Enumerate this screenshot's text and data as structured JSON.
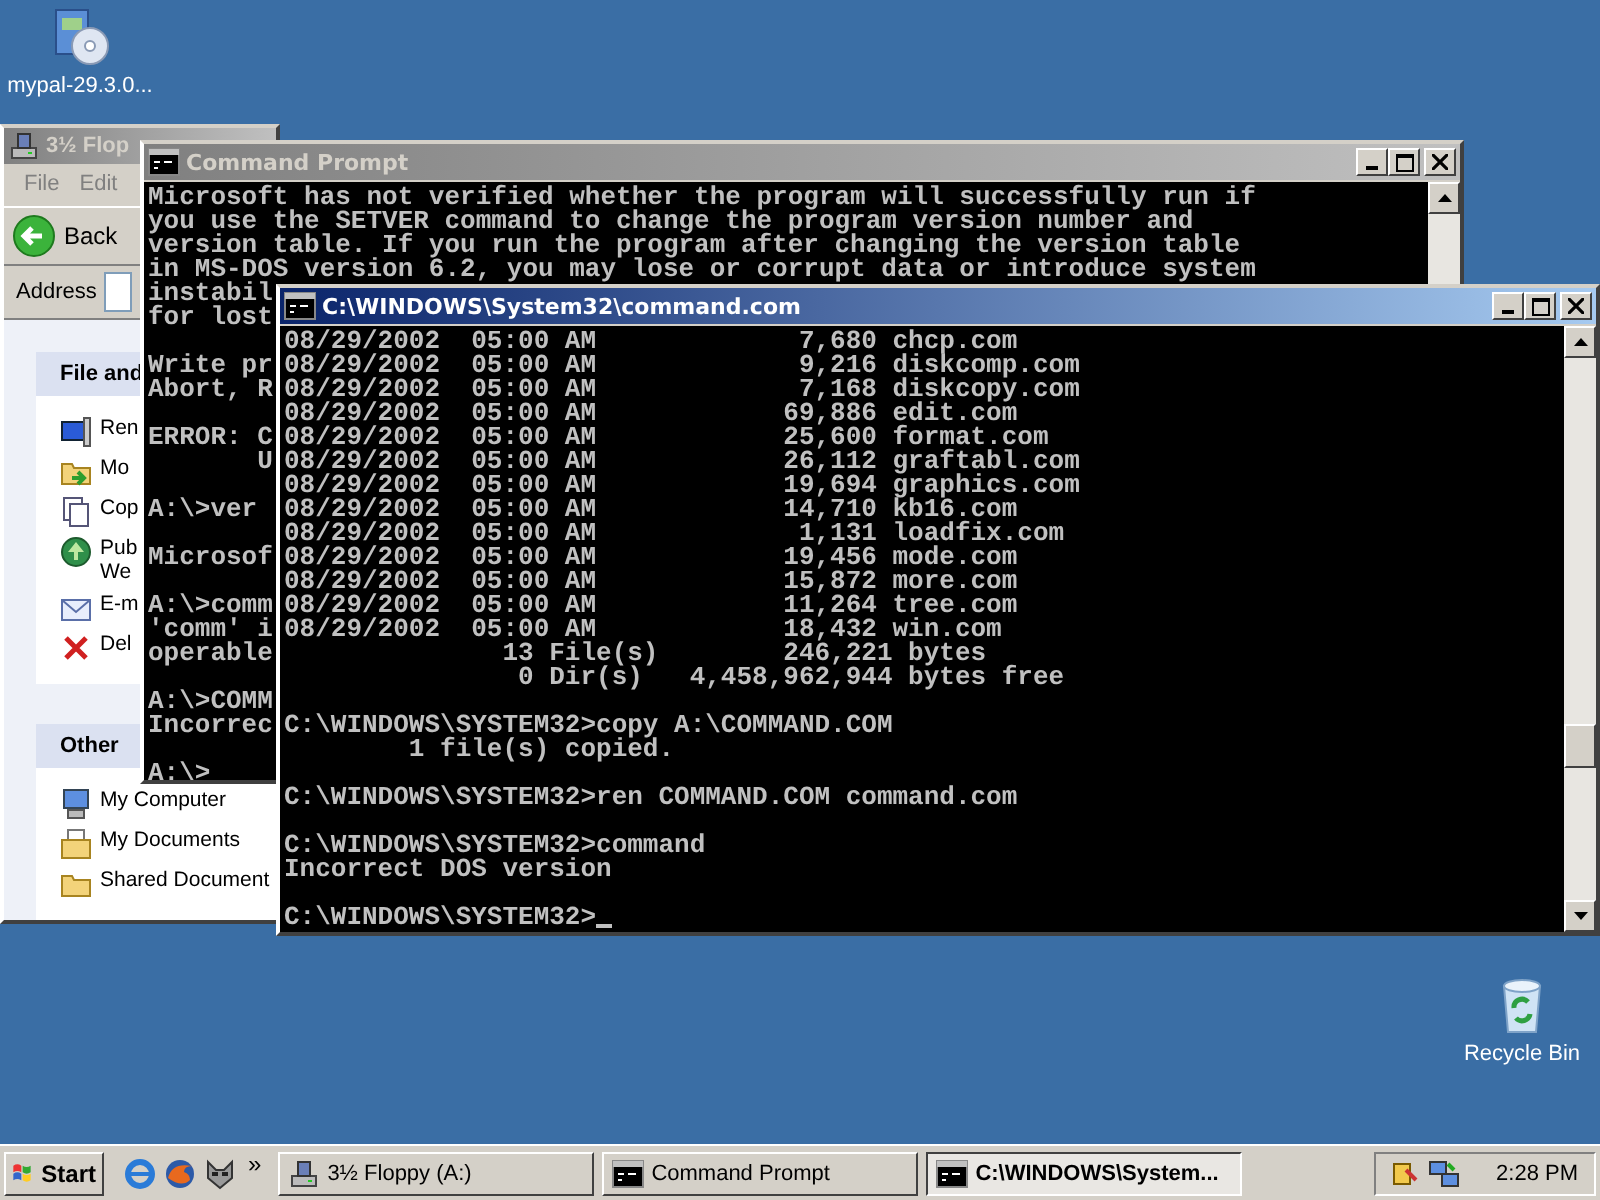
{
  "desktop_icons": [
    {
      "label": "mypal-29.3.0...",
      "kind": "installer"
    },
    {
      "label": "Recycle Bin",
      "kind": "recycle"
    }
  ],
  "explorer": {
    "title": "3½ Flop",
    "active": false,
    "menu": [
      "File",
      "Edit"
    ],
    "back_button": "Back",
    "address_label": "Address",
    "task_panels": [
      {
        "title": "File and",
        "items": [
          {
            "label": "Ren",
            "kind": "rename"
          },
          {
            "label": "Mo",
            "kind": "move"
          },
          {
            "label": "Cop",
            "kind": "copy"
          },
          {
            "label": "Pub\nWe",
            "kind": "publish"
          },
          {
            "label": "E-m",
            "kind": "email"
          },
          {
            "label": "Del",
            "kind": "delete"
          }
        ]
      },
      {
        "title": "Other",
        "items": [
          {
            "label": "My Computer",
            "kind": "computer"
          },
          {
            "label": "My Documents",
            "kind": "documents"
          },
          {
            "label": "Shared Document",
            "kind": "shared"
          }
        ]
      }
    ]
  },
  "console_back": {
    "title": "Command Prompt",
    "active": false,
    "blocks": [
      [
        "Microsoft has not verified whether the program will successfully run if",
        "you use the SETVER command to change the program version number and",
        "version table. If you run the program after changing the version table",
        "in MS-DOS version 6.2, you may lose or corrupt data or introduce system",
        "instabil",
        "for lost"
      ],
      [
        "Write pr",
        "Abort, R"
      ],
      [
        "ERROR: C",
        "       U"
      ],
      [
        "A:\\>ver"
      ],
      [
        "Microsof"
      ],
      [
        "A:\\>comm",
        "'comm' i",
        "operable"
      ],
      [
        "A:\\>COMM",
        "Incorrec"
      ],
      [
        "A:\\>"
      ]
    ]
  },
  "console_front": {
    "title": "C:\\WINDOWS\\System32\\command.com",
    "active": true,
    "cursor": true,
    "blocks": [
      [
        "08/29/2002  05:00 AM             7,680 chcp.com",
        "08/29/2002  05:00 AM             9,216 diskcomp.com",
        "08/29/2002  05:00 AM             7,168 diskcopy.com",
        "08/29/2002  05:00 AM            69,886 edit.com",
        "08/29/2002  05:00 AM            25,600 format.com",
        "08/29/2002  05:00 AM            26,112 graftabl.com",
        "08/29/2002  05:00 AM            19,694 graphics.com",
        "08/29/2002  05:00 AM            14,710 kb16.com",
        "08/29/2002  05:00 AM             1,131 loadfix.com",
        "08/29/2002  05:00 AM            19,456 mode.com",
        "08/29/2002  05:00 AM            15,872 more.com",
        "08/29/2002  05:00 AM            11,264 tree.com",
        "08/29/2002  05:00 AM            18,432 win.com",
        "              13 File(s)        246,221 bytes",
        "               0 Dir(s)   4,458,962,944 bytes free"
      ],
      [
        "C:\\WINDOWS\\SYSTEM32>copy A:\\COMMAND.COM",
        "        1 file(s) copied."
      ],
      [
        "C:\\WINDOWS\\SYSTEM32>ren COMMAND.COM command.com"
      ],
      [
        "C:\\WINDOWS\\SYSTEM32>command",
        "Incorrect DOS version"
      ],
      [
        "C:\\WINDOWS\\SYSTEM32>"
      ]
    ]
  },
  "taskbar": {
    "start": "Start",
    "chevron": "»",
    "tasks": [
      {
        "label": "3½ Floppy (A:)",
        "kind": "drive",
        "selected": false
      },
      {
        "label": "Command Prompt",
        "kind": "console",
        "selected": false
      },
      {
        "label": "C:\\WINDOWS\\System...",
        "kind": "console",
        "selected": true
      }
    ],
    "clock": "2:28 PM"
  }
}
